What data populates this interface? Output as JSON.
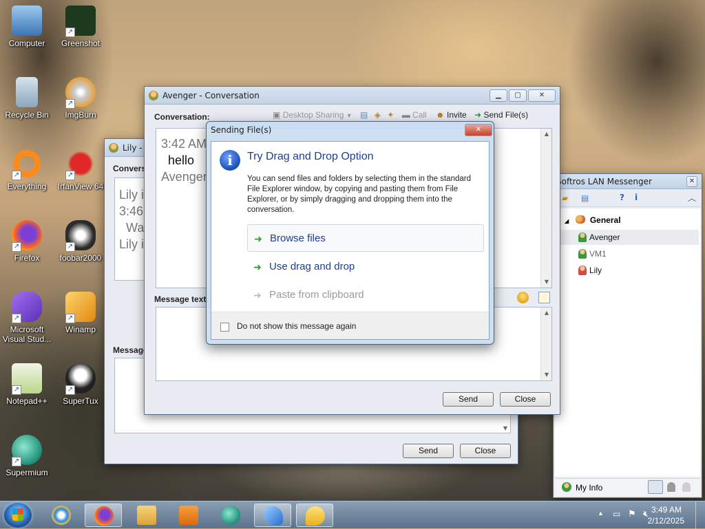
{
  "desktop": {
    "icons": [
      {
        "label": "Computer",
        "icon": "computer-icon",
        "color": "#5b9ad6"
      },
      {
        "label": "Greenshot",
        "icon": "greenshot-icon",
        "color": "#1e3a1e"
      },
      {
        "label": "Recycle Bin",
        "icon": "recycle-bin-icon",
        "color": "#a9c3d6"
      },
      {
        "label": "ImgBurn",
        "icon": "imgburn-icon",
        "color": "#d68a2b"
      },
      {
        "label": "Everything",
        "icon": "everything-icon",
        "color": "#ff8a1a"
      },
      {
        "label": "IrfanView 64",
        "icon": "irfanview-icon",
        "color": "#d32020"
      },
      {
        "label": "Firefox",
        "icon": "firefox-icon",
        "color": "#ff6a1a"
      },
      {
        "label": "foobar2000",
        "icon": "foobar2000-icon",
        "color": "#2b2b2b"
      },
      {
        "label": "Microsoft Visual Stud...",
        "icon": "visual-studio-icon",
        "color": "#7a4fd0"
      },
      {
        "label": "Winamp",
        "icon": "winamp-icon",
        "color": "#f0a020"
      },
      {
        "label": "Notepad++",
        "icon": "notepad-plus-plus-icon",
        "color": "#7ac043"
      },
      {
        "label": "SuperTux",
        "icon": "supertux-icon",
        "color": "#333"
      },
      {
        "label": "Supermium",
        "icon": "supermium-icon",
        "color": "#2aa88c"
      }
    ]
  },
  "lily_window": {
    "title": "Lily - ",
    "conversation_label": "Convers",
    "lines": [
      "Lily i",
      "3:46",
      "Wa",
      "Lily i"
    ],
    "message_label": "Message",
    "send_label": "Send",
    "close_label": "Close"
  },
  "avenger_window": {
    "title": "Avenger - Conversation",
    "conversation_label": "Conversation:",
    "toolbar": {
      "desktop_sharing": "Desktop Sharing",
      "call": "Call",
      "invite": "Invite",
      "send_files": "Send File(s)"
    },
    "conversation": {
      "time": "3:42 AM",
      "message": "hello",
      "sender": "Avenger"
    },
    "message_text_label": "Message text:",
    "send_label": "Send",
    "close_label": "Close"
  },
  "messenger": {
    "title": "Softros LAN Messenger",
    "group": "General",
    "contacts": [
      {
        "name": "Avenger",
        "status_color": "#3a9a3a",
        "selected": true
      },
      {
        "name": "VM1",
        "status_color": "#3a9a3a",
        "dim": true
      },
      {
        "name": "Lily",
        "status_color": "#c83232"
      }
    ],
    "my_info": "My Info"
  },
  "dialog": {
    "title": "Sending File(s)",
    "heading": "Try Drag and Drop Option",
    "body": "You can send files and folders by selecting them in the standard File Explorer window, by copying and pasting them from File Explorer, or by simply dragging and dropping them into the conversation.",
    "options": [
      {
        "label": "Browse files",
        "enabled": true
      },
      {
        "label": "Use drag and drop",
        "enabled": true
      },
      {
        "label": "Paste from clipboard",
        "enabled": false
      }
    ],
    "checkbox_label": "Do not show this message again"
  },
  "taskbar": {
    "time": "3:49 AM",
    "date": "2/12/2025"
  },
  "colors": {
    "accent": "#1b3f94",
    "close_red": "#c7422f"
  }
}
